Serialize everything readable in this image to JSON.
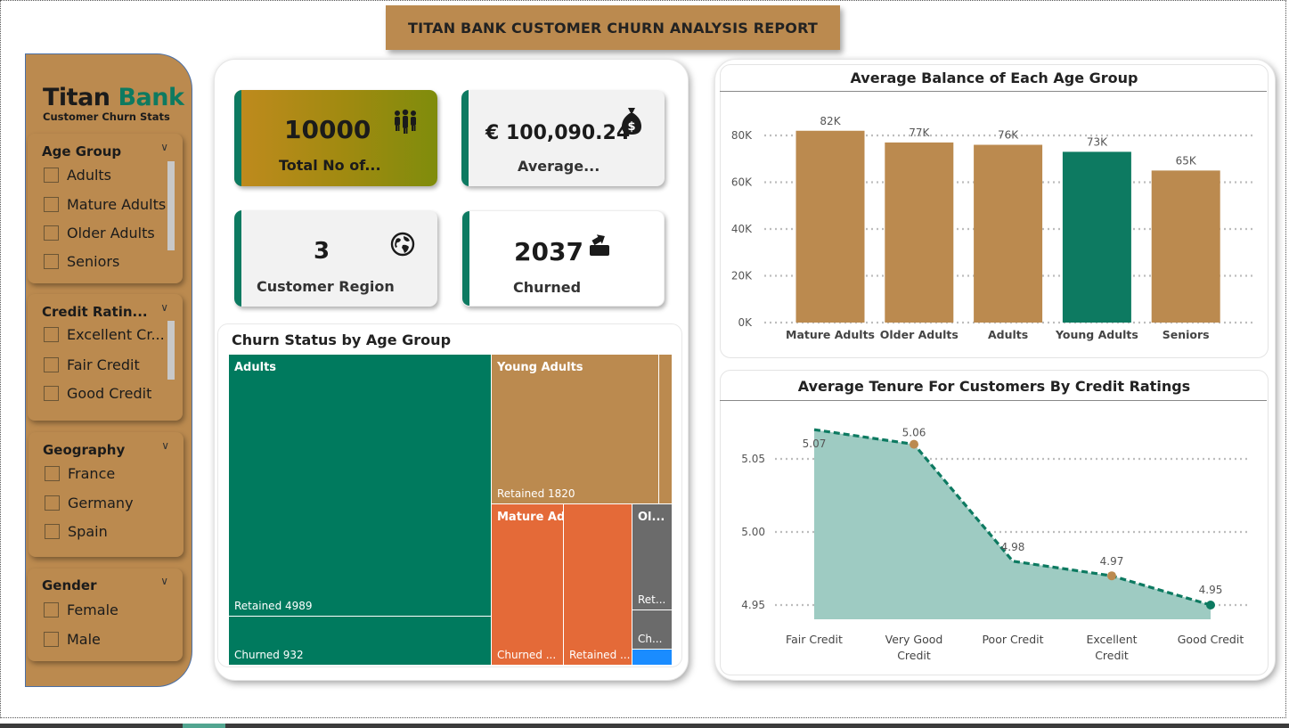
{
  "report_title": "TITAN BANK CUSTOMER CHURN ANALYSIS REPORT",
  "brand": {
    "name_part1": "Titan",
    "name_part2": "Bank",
    "subtitle": "Customer Churn Stats"
  },
  "slicers": {
    "age_group": {
      "title": "Age Group",
      "items": [
        "Adults",
        "Mature Adults",
        "Older Adults",
        "Seniors"
      ]
    },
    "credit_rating": {
      "title": "Credit Ratin...",
      "items": [
        "Excellent Cr...",
        "Fair Credit",
        "Good Credit"
      ]
    },
    "geography": {
      "title": "Geography",
      "items": [
        "France",
        "Germany",
        "Spain"
      ]
    },
    "gender": {
      "title": "Gender",
      "items": [
        "Female",
        "Male"
      ]
    }
  },
  "kpis": {
    "total_customers": {
      "value": "10000",
      "label": "Total No of...",
      "icon": "people-icon"
    },
    "average_balance": {
      "value": "€ 100,090.24",
      "label": "Average...",
      "icon": "money-bag-icon"
    },
    "customer_region": {
      "value": "3",
      "label": "Customer Region",
      "icon": "globe-icon"
    },
    "churned": {
      "value": "2037",
      "label": "Churned",
      "icon": "exit-icon"
    }
  },
  "treemap": {
    "title": "Churn Status by Age Group",
    "cells": {
      "adults_header": "Adults",
      "adults_retained": "Retained 4989",
      "adults_churned": "Churned 932",
      "young_header": "Young Adults",
      "young_retained": "Retained 1820",
      "mature_header": "Mature Adults",
      "mature_churned": "Churned ...",
      "mature_retained": "Retained ...",
      "older_header": "Ol...",
      "older_retained": "Ret...",
      "older_churned": "Ch..."
    }
  },
  "colors": {
    "brand_tan": "#bb8a4f",
    "brand_green": "#0d7a61",
    "mature_orange": "#e46a38",
    "older_gray": "#6b6b6b",
    "seniors_blue": "#1a8cff",
    "area_fill": "#9ecbc2"
  },
  "chart_data": [
    {
      "type": "bar",
      "title": "Average Balance of Each Age Group",
      "categories": [
        "Mature Adults",
        "Older Adults",
        "Adults",
        "Young Adults",
        "Seniors"
      ],
      "values": [
        82000,
        77000,
        76000,
        73000,
        65000
      ],
      "data_labels": [
        "82K",
        "77K",
        "76K",
        "73K",
        "65K"
      ],
      "yticks": [
        "0K",
        "20K",
        "40K",
        "60K",
        "80K"
      ],
      "ylim": [
        0,
        85000
      ],
      "highlight": "Young Adults",
      "grid": true
    },
    {
      "type": "area",
      "title": "Average Tenure For Customers By Credit Ratings",
      "categories": [
        "Fair Credit",
        "Very Good Credit",
        "Poor Credit",
        "Excellent Credit",
        "Good Credit"
      ],
      "values": [
        5.07,
        5.06,
        4.98,
        4.97,
        4.95
      ],
      "data_labels": [
        "5.07",
        "5.06",
        "4.98",
        "4.97",
        "4.95"
      ],
      "yticks": [
        "4.95",
        "5.00",
        "5.05"
      ],
      "ylim": [
        4.94,
        5.07
      ],
      "grid": true
    }
  ]
}
